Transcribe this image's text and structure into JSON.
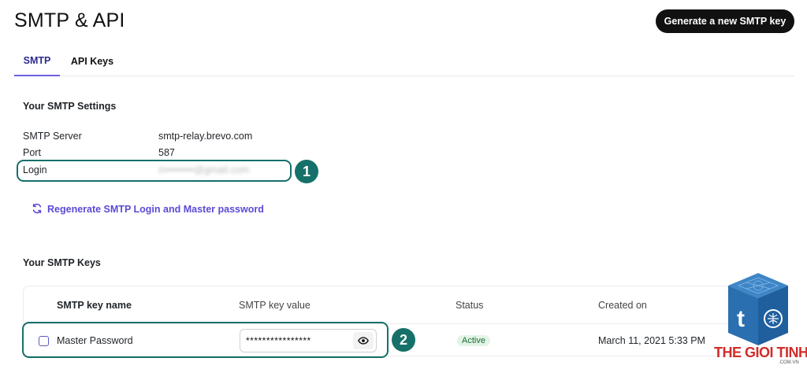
{
  "header": {
    "title": "SMTP & API",
    "primary_action": "Generate a new SMTP key"
  },
  "tabs": [
    {
      "label": "SMTP",
      "active": true
    },
    {
      "label": "API Keys",
      "active": false
    }
  ],
  "smtp_settings": {
    "title": "Your SMTP Settings",
    "server_label": "SMTP Server",
    "server_value": "smtp-relay.brevo.com",
    "port_label": "Port",
    "port_value": "587",
    "login_label": "Login",
    "login_value": "m••••••••@gmail.com",
    "regenerate_label": "Regenerate SMTP Login and Master password"
  },
  "smtp_keys": {
    "title": "Your SMTP Keys",
    "columns": [
      "SMTP key name",
      "SMTP key value",
      "Status",
      "Created on"
    ],
    "rows": [
      {
        "name": "Master Password",
        "value": "****************",
        "status": "Active",
        "created_on": "March 11, 2021 5:33 PM"
      }
    ]
  },
  "annotations": [
    "1",
    "2"
  ],
  "watermark": {
    "brand": "THE GIOI TINHOC",
    "domain": ".COM.VN"
  },
  "colors": {
    "accent": "#6d5fe0",
    "link": "#5b4ad6",
    "annotation": "#16706a",
    "primary_button": "#111111",
    "status_active_bg": "#e2f4e6",
    "watermark_blue": "#2f74b5",
    "watermark_red": "#d12d2a"
  }
}
